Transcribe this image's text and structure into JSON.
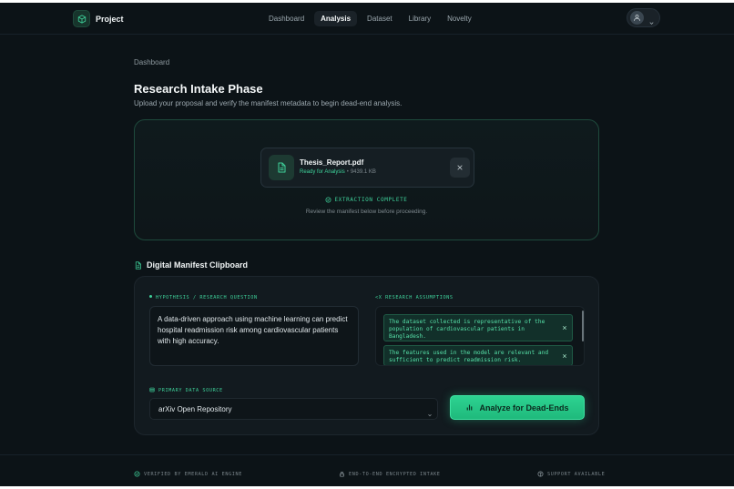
{
  "app": {
    "name": "Project"
  },
  "nav": {
    "items": [
      {
        "label": "Dashboard",
        "active": false
      },
      {
        "label": "Analysis",
        "active": true
      },
      {
        "label": "Dataset",
        "active": false
      },
      {
        "label": "Library",
        "active": false
      },
      {
        "label": "Novelty",
        "active": false
      }
    ]
  },
  "breadcrumb": "Dashboard",
  "page": {
    "title": "Research Intake Phase",
    "subtitle": "Upload your proposal and verify the manifest metadata to begin dead-end analysis."
  },
  "upload": {
    "file_name": "Thesis_Report.pdf",
    "status": "Ready for Analysis",
    "separator": "•",
    "size": "9439.1 KB",
    "extraction_status": "EXTRACTION COMPLETE",
    "extraction_hint": "Review the manifest below before proceeding."
  },
  "manifest": {
    "title": "Digital Manifest Clipboard",
    "hypothesis_label": "HYPOTHESIS / RESEARCH QUESTION",
    "hypothesis_text": "A data-driven approach using machine learning can predict hospital readmission risk among cardiovascular patients with high accuracy.",
    "assumptions_label": "<X RESEARCH ASSUMPTIONS",
    "assumptions": [
      "The dataset collected is representative of the population of cardiovascular patients in Bangladesh.",
      "The features used in the model are relevant and sufficient to predict readmission risk."
    ],
    "source_label": "PRIMARY DATA SOURCE",
    "source_value": "arXiv Open Repository",
    "analyze_label": "Analyze for Dead-Ends"
  },
  "footer": {
    "verified": "VERIFIED BY EMERALD AI ENGINE",
    "encrypted": "END-TO-END ENCRYPTED INTAKE",
    "support": "SUPPORT AVAILABLE"
  },
  "colors": {
    "background": "#0c1317",
    "accent": "#2ed692",
    "panel": "#121a1f"
  }
}
